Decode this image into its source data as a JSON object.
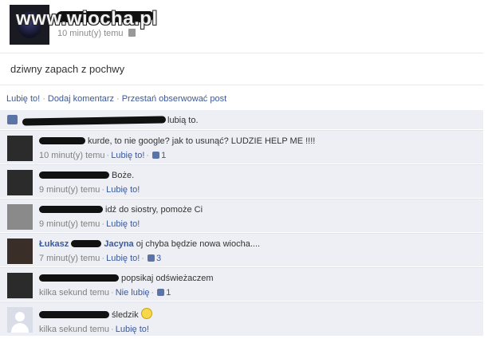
{
  "post": {
    "watermark": "www.wiocha.pl",
    "time": "10 minut(y) temu",
    "text": "dziwny zapach z pochwy"
  },
  "actions": {
    "like": "Lubię to!",
    "comment": "Dodaj komentarz",
    "unfollow": "Przestań obserwować post"
  },
  "likes": {
    "suffix": "lubią to."
  },
  "comments": [
    {
      "name": "",
      "text": "kurde, to nie google? jak to usunąć? LUDZIE HELP ME !!!!",
      "time": "10 minut(y) temu",
      "action": "Lubię to!",
      "likes": "1"
    },
    {
      "name": "",
      "text": "Boże.",
      "time": "9 minut(y) temu",
      "action": "Lubię to!",
      "likes": ""
    },
    {
      "name": "",
      "text": "idź do siostry, pomoże Ci",
      "time": "9 minut(y) temu",
      "action": "Lubię to!",
      "likes": ""
    },
    {
      "name_first": "Łukasz",
      "name_last": "Jacyna",
      "text": "oj chyba będzie nowa wiocha....",
      "time": "7 minut(y) temu",
      "action": "Lubię to!",
      "likes": "3"
    },
    {
      "name": "",
      "text": "popsikaj odświeżaczem",
      "time": "kilka sekund temu",
      "action": "Nie lubię",
      "likes": "1"
    },
    {
      "name": "",
      "text": "śledzik",
      "time": "kilka sekund temu",
      "action": "Lubię to!",
      "likes": ""
    }
  ],
  "colors": {
    "link": "#3b5998",
    "ufi_bg": "#edeff4"
  }
}
